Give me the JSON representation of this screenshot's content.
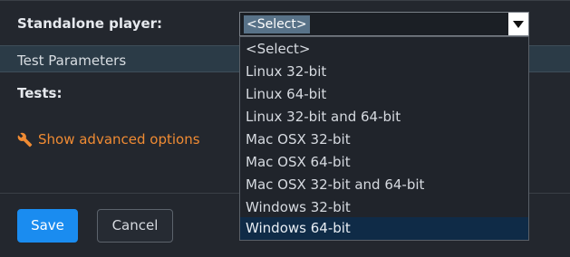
{
  "form": {
    "standalone_label": "Standalone player:",
    "tests_label": "Tests:",
    "advanced_link": "Show advanced options"
  },
  "section": {
    "title": "Test Parameters"
  },
  "select": {
    "value": "<Select>",
    "options": [
      "<Select>",
      "Linux 32-bit",
      "Linux 64-bit",
      "Linux 32-bit and 64-bit",
      "Mac OSX 32-bit",
      "Mac OSX 64-bit",
      "Mac OSX 32-bit and 64-bit",
      "Windows 32-bit",
      "Windows 64-bit"
    ],
    "highlighted_option": "Windows 64-bit"
  },
  "buttons": {
    "save": "Save",
    "cancel": "Cancel"
  },
  "colors": {
    "accent": "#1a8cf0",
    "link": "#f08b33",
    "highlight": "#0f2b47"
  },
  "icons": {
    "advanced": "wrench-icon",
    "dropdown": "caret-down-icon"
  }
}
